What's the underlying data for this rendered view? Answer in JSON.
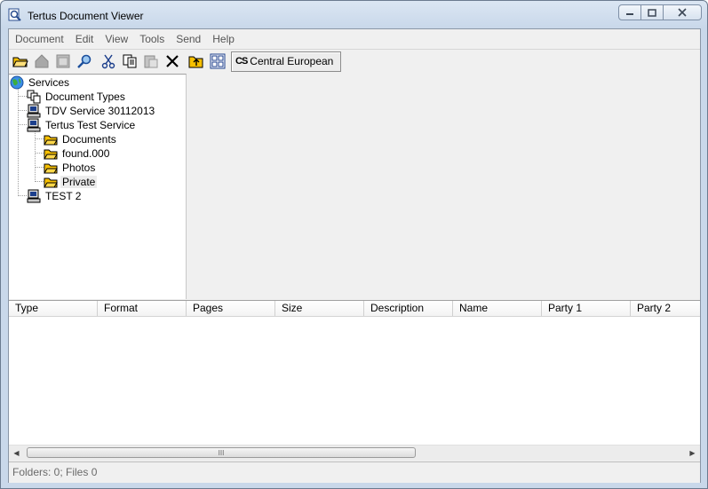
{
  "window": {
    "title": "Tertus Document Viewer"
  },
  "menu": [
    "Document",
    "Edit",
    "View",
    "Tools",
    "Send",
    "Help"
  ],
  "toolbar": {
    "icons": [
      "open-folder-icon",
      "home-icon",
      "window-icon",
      "search-icon",
      "cut-icon",
      "copy-icon",
      "paste-icon",
      "delete-icon",
      "folder-up-icon",
      "thumbnails-icon"
    ],
    "encoding_glyph": "CS",
    "encoding_label": "Central European"
  },
  "tree": {
    "root": "Services",
    "items": [
      {
        "label": "Document Types",
        "level": 1,
        "icon": "document-types-icon"
      },
      {
        "label": "TDV Service 30112013",
        "level": 1,
        "icon": "computer-icon"
      },
      {
        "label": "Tertus Test Service",
        "level": 1,
        "icon": "computer-icon"
      },
      {
        "label": "Documents",
        "level": 2,
        "icon": "folder-icon"
      },
      {
        "label": "found.000",
        "level": 2,
        "icon": "folder-icon"
      },
      {
        "label": "Photos",
        "level": 2,
        "icon": "folder-icon"
      },
      {
        "label": "Private",
        "level": 2,
        "icon": "folder-icon",
        "selected": true
      },
      {
        "label": "TEST 2",
        "level": 1,
        "icon": "computer-icon"
      }
    ]
  },
  "list": {
    "columns": [
      "Type",
      "Format",
      "Pages",
      "Size",
      "Description",
      "Name",
      "Party 1",
      "Party 2"
    ],
    "rows": []
  },
  "scrollbar": {
    "thumb_glyph": "III"
  },
  "status": {
    "text": "Folders: 0; Files 0"
  },
  "colors": {
    "folder": "#f7c000",
    "selection": "#ececec",
    "title_bar": "#c9d8ea"
  }
}
